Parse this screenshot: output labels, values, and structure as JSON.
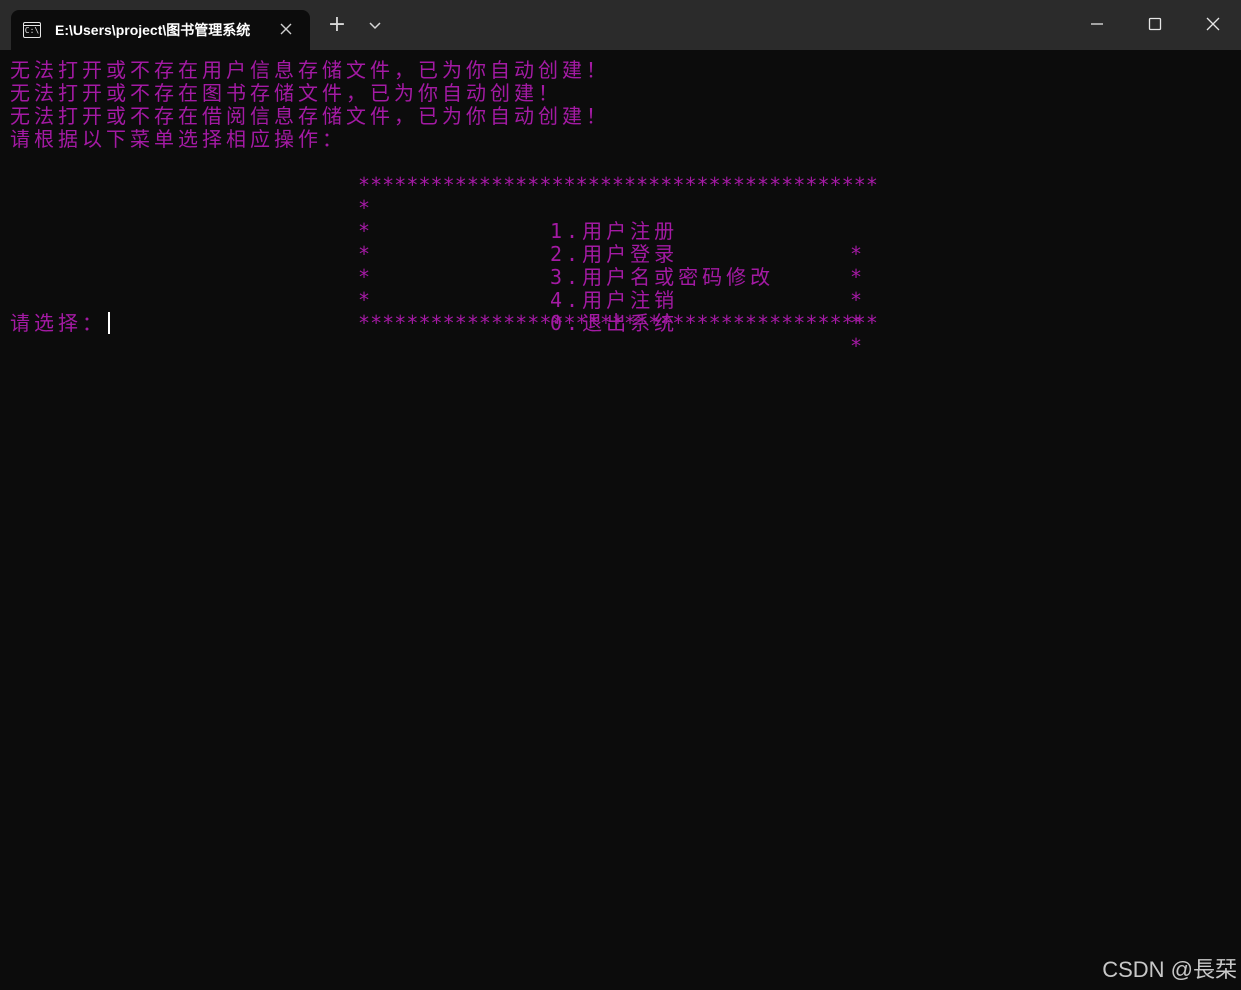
{
  "window": {
    "tab_title": "E:\\Users\\project\\图书管理系统",
    "tab_icon": "terminal-icon",
    "tab_icon_text": "C:\\",
    "new_tab_label": "+"
  },
  "terminal": {
    "text_color": "#a41aa4",
    "background": "#0c0c0c",
    "lines": [
      "无法打开或不存在用户信息存储文件，已为你自动创建！",
      "无法打开或不存在图书存储文件，已为你自动创建！",
      "无法打开或不存在借阅信息存储文件，已为你自动创建！",
      "请根据以下菜单选择相应操作："
    ],
    "menu": {
      "border": "*******************************************",
      "side_star": "*",
      "items": [
        "1.用户注册",
        "2.用户登录",
        "3.用户名或密码修改",
        "4.用户注销",
        "0.退出系统"
      ]
    },
    "prompt": "请选择："
  },
  "watermark": "CSDN @長栞"
}
